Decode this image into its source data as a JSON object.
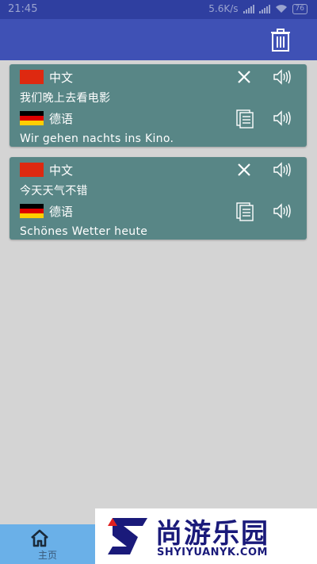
{
  "status_bar": {
    "time": "21:45",
    "speed": "5.6K/s",
    "battery": "76"
  },
  "cards": [
    {
      "source_lang": "中文",
      "source_text": "我们晚上去看电影",
      "target_lang": "德语",
      "target_text": "Wir gehen nachts ins Kino."
    },
    {
      "source_lang": "中文",
      "source_text": "今天天气不错",
      "target_lang": "德语",
      "target_text": "Schönes Wetter heute"
    }
  ],
  "bottom_nav": {
    "home_label": "主页"
  },
  "banner": {
    "brand": "尚游乐园",
    "domain": "SHYIYUANYK.COM"
  },
  "colors": {
    "app_bar": "#3f51b5",
    "status_bar": "#2f3fa0",
    "card": "#588686",
    "background": "#d4d4d4",
    "bottom_nav": "#6ab0e8"
  }
}
